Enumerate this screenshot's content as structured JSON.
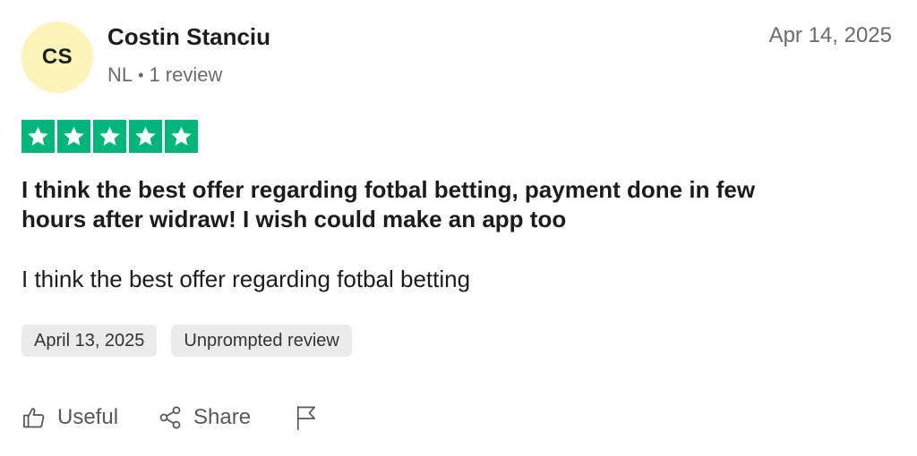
{
  "reviewer": {
    "initials": "CS",
    "name": "Costin Stanciu",
    "country": "NL",
    "separator": "•",
    "review_count": "1 review",
    "avatar_color": "#fcf3b9"
  },
  "review": {
    "date": "Apr 14, 2025",
    "rating": 5,
    "max_rating": 5,
    "star_color": "#00b67a",
    "title": "I think the best offer regarding fotbal betting, payment done in few hours after widraw! I wish could make an app too",
    "body": "I think the best offer regarding fotbal betting",
    "tags": [
      "April 13, 2025",
      "Unprompted review"
    ]
  },
  "actions": {
    "useful_label": "Useful",
    "useful_icon": "thumbs-up-icon",
    "share_label": "Share",
    "share_icon": "share-icon",
    "report_icon": "flag-icon"
  }
}
